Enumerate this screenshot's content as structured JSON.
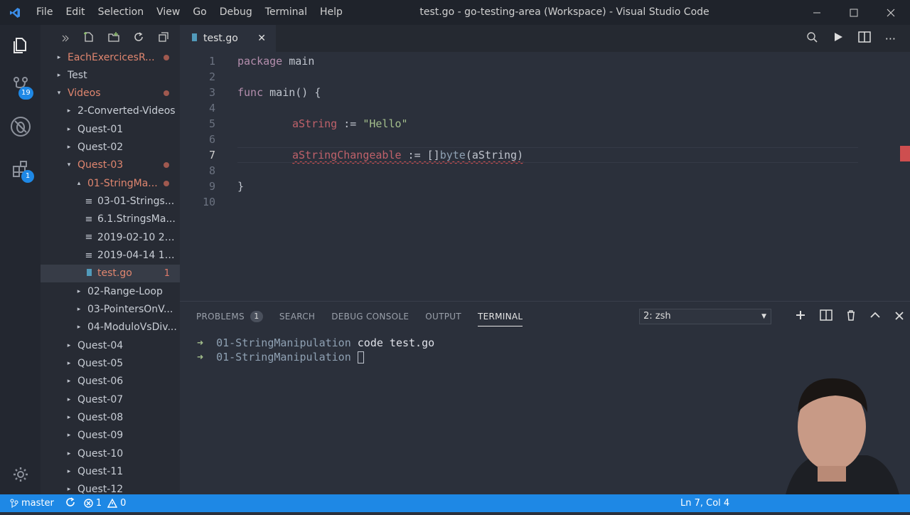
{
  "titlebar": {
    "menu": [
      "File",
      "Edit",
      "Selection",
      "View",
      "Go",
      "Debug",
      "Terminal",
      "Help"
    ],
    "title": "test.go - go-testing-area (Workspace) - Visual Studio Code"
  },
  "activity": {
    "scm_badge": "19",
    "extensions_badge": "1"
  },
  "explorer": {
    "items": [
      {
        "label": "EachExercicesR...",
        "caret": "▸",
        "red": true,
        "dot": true
      },
      {
        "label": "Test",
        "caret": "▸"
      },
      {
        "label": "Videos",
        "caret": "▾",
        "red": true,
        "dot": true
      },
      {
        "label": "2-Converted-Videos",
        "caret": "▸"
      },
      {
        "label": "Quest-01",
        "caret": "▸"
      },
      {
        "label": "Quest-02",
        "caret": "▸"
      },
      {
        "label": "Quest-03",
        "caret": "▾",
        "red": true,
        "dot": true
      },
      {
        "label": "01-StringMa...",
        "caret": "▴",
        "red": true,
        "dot": true
      },
      {
        "label": "03-01-Strings...",
        "caret": "≡"
      },
      {
        "label": "6.1.StringsMa...",
        "caret": "≡"
      },
      {
        "label": "2019-02-10 22...",
        "caret": "≡"
      },
      {
        "label": "2019-04-14 19...",
        "caret": "≡"
      },
      {
        "label": "test.go",
        "caret": "go",
        "red": true,
        "count": "1",
        "selected": true
      },
      {
        "label": "02-Range-Loop",
        "caret": "▸"
      },
      {
        "label": "03-PointersOnV...",
        "caret": "▸"
      },
      {
        "label": "04-ModuloVsDiv...",
        "caret": "▸"
      },
      {
        "label": "Quest-04",
        "caret": "▸"
      },
      {
        "label": "Quest-05",
        "caret": "▸"
      },
      {
        "label": "Quest-06",
        "caret": "▸"
      },
      {
        "label": "Quest-07",
        "caret": "▸"
      },
      {
        "label": "Quest-08",
        "caret": "▸"
      },
      {
        "label": "Quest-09",
        "caret": "▸"
      },
      {
        "label": "Quest-10",
        "caret": "▸"
      },
      {
        "label": "Quest-11",
        "caret": "▸"
      },
      {
        "label": "Quest-12",
        "caret": "▸"
      }
    ]
  },
  "editor": {
    "tab_label": "test.go",
    "line_numbers": [
      "1",
      "2",
      "3",
      "4",
      "5",
      "6",
      "7",
      "8",
      "9",
      "10"
    ],
    "code": {
      "l1_kw": "package",
      "l1_rest": " main",
      "l3_kw": "func",
      "l3_rest": " main() {",
      "l5_ident": "aString",
      "l5_op": " := ",
      "l5_str": "\"Hello\"",
      "l7_ident": "aStringChangeable",
      "l7_op": " := []",
      "l7_fn": "byte",
      "l7_arg": "(aString)",
      "l9": "}"
    }
  },
  "panel": {
    "tabs": [
      "PROBLEMS",
      "SEARCH",
      "DEBUG CONSOLE",
      "OUTPUT",
      "TERMINAL"
    ],
    "problems_count": "1",
    "terminal_select": "2: zsh",
    "terminal_lines": [
      {
        "prompt": "➜",
        "dir": "01-StringManipulation",
        "cmd": " code test.go"
      },
      {
        "prompt": "➜",
        "dir": "01-StringManipulation",
        "cmd": " "
      }
    ]
  },
  "status": {
    "branch": "master",
    "errors": "1",
    "warnings": "0",
    "position": "Ln 7, Col 4"
  },
  "colors": {
    "statusbar": "#1e88e5",
    "error": "#e05252"
  }
}
